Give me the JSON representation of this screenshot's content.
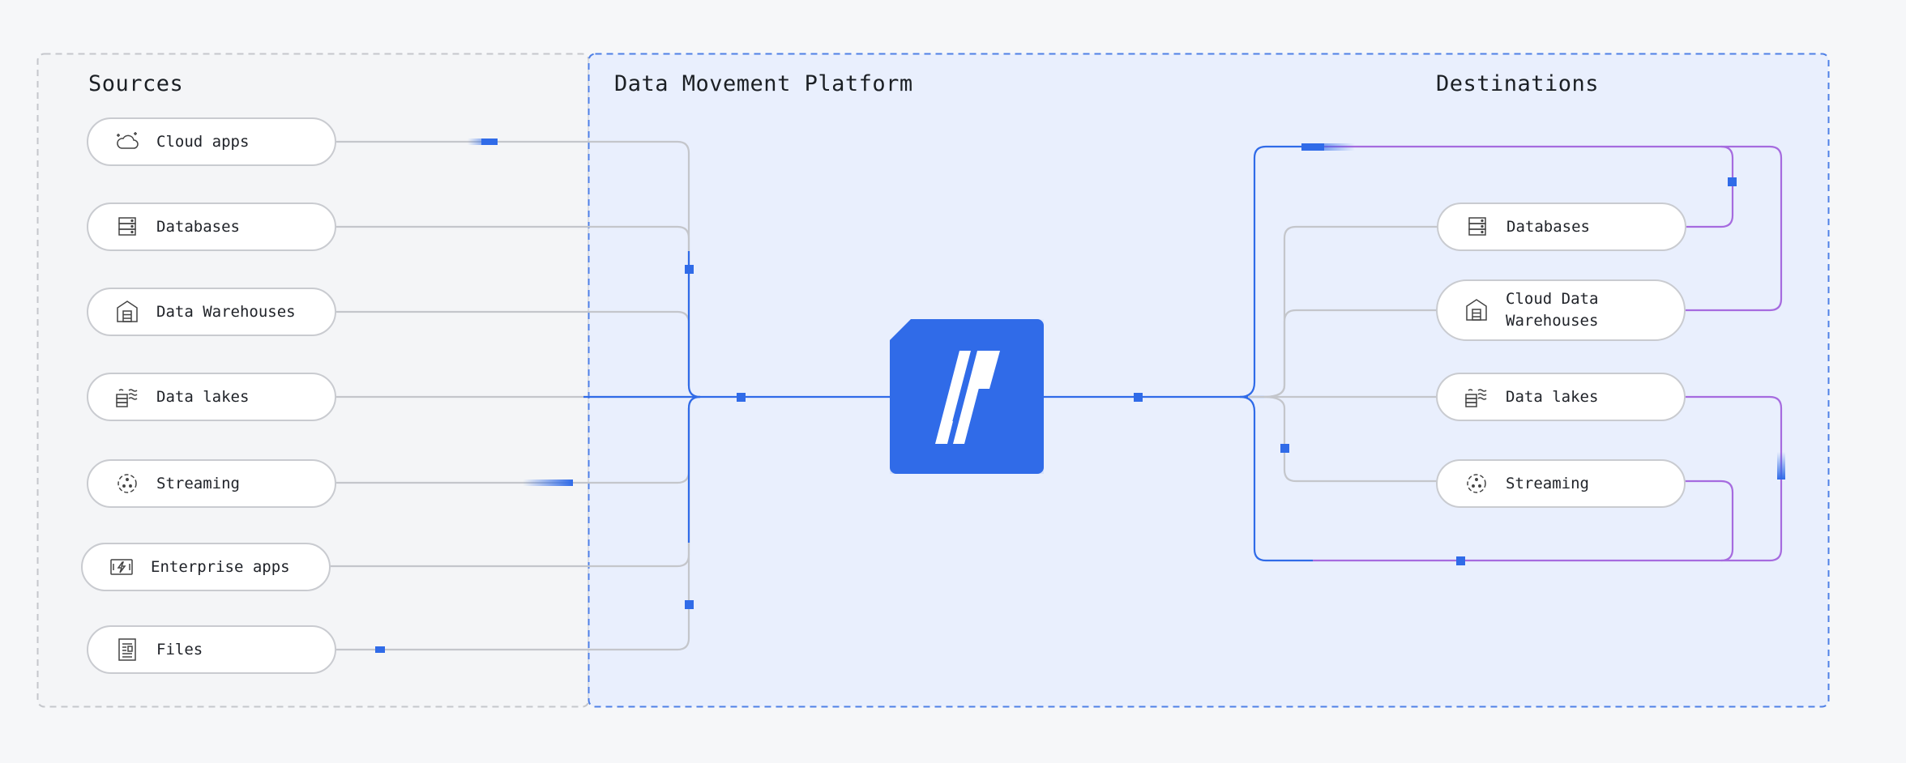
{
  "sections": {
    "sources": "Sources",
    "platform": "Data Movement Platform",
    "destinations": "Destinations"
  },
  "sources": [
    {
      "label": "Cloud apps",
      "icon": "cloud-icon"
    },
    {
      "label": "Databases",
      "icon": "database-icon"
    },
    {
      "label": "Data Warehouses",
      "icon": "warehouse-icon"
    },
    {
      "label": "Data lakes",
      "icon": "data-lake-icon"
    },
    {
      "label": "Streaming",
      "icon": "streaming-icon"
    },
    {
      "label": "Enterprise apps",
      "icon": "enterprise-app-icon"
    },
    {
      "label": "Files",
      "icon": "file-icon"
    }
  ],
  "destinations": [
    {
      "label": "Databases",
      "icon": "database-icon"
    },
    {
      "label": "Cloud Data\nWarehouses",
      "icon": "warehouse-icon"
    },
    {
      "label": "Data lakes",
      "icon": "data-lake-icon"
    },
    {
      "label": "Streaming",
      "icon": "streaming-icon"
    }
  ],
  "colors": {
    "accent": "#306be8",
    "line_gray": "#c4c6cb",
    "line_purple": "#a66bdf",
    "platform_bg": "#e9effd",
    "sources_bg": "#f4f5f7",
    "pill_border": "#c9cbd0"
  },
  "logo": "platform-logo"
}
